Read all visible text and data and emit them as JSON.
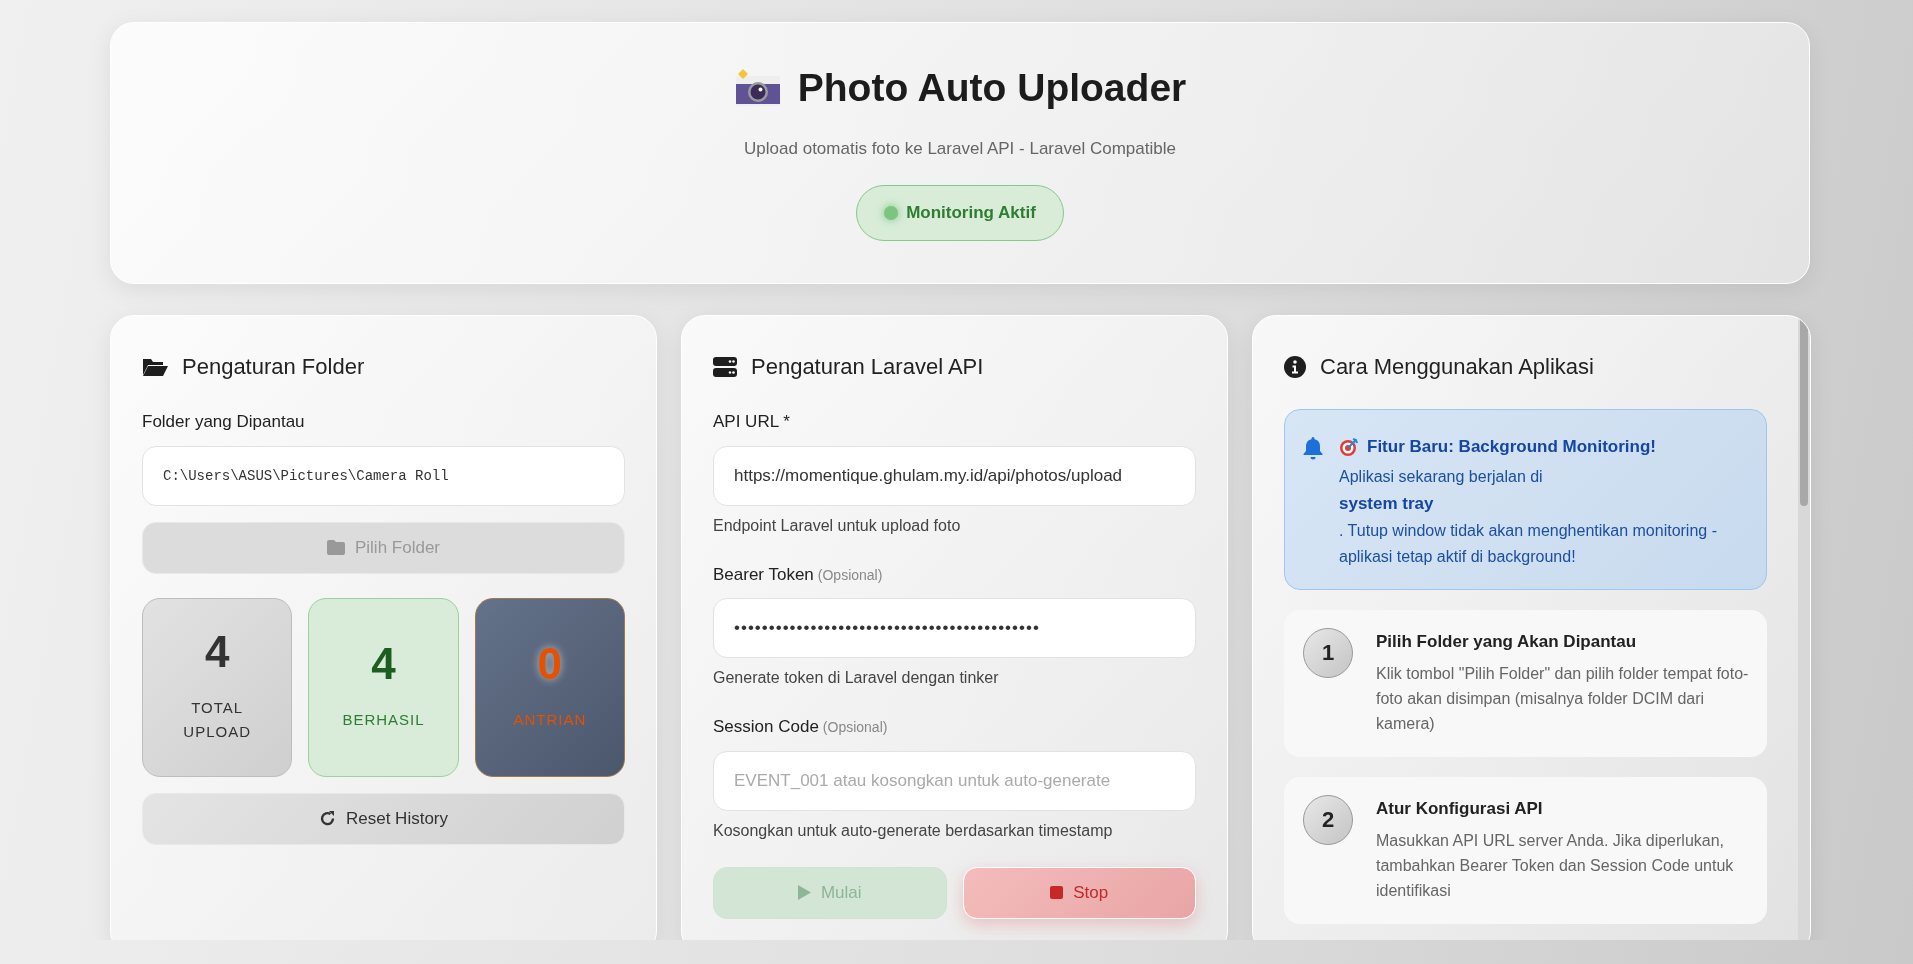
{
  "header": {
    "title": "Photo Auto Uploader",
    "subtitle": "Upload otomatis foto ke Laravel API - Laravel Compatible",
    "status": {
      "label": "Monitoring Aktif",
      "active": true
    }
  },
  "folder_panel": {
    "title": "Pengaturan Folder",
    "field_label": "Folder yang Dipantau",
    "folder_path": "C:\\Users\\ASUS\\Pictures\\Camera Roll",
    "choose_button": {
      "label": "Pilih Folder",
      "disabled": true
    },
    "stats": [
      {
        "kind": "total",
        "value": "4",
        "label": "TOTAL UPLOAD"
      },
      {
        "kind": "success",
        "value": "4",
        "label": "BERHASIL"
      },
      {
        "kind": "queue",
        "value": "0",
        "label": "ANTRIAN"
      }
    ],
    "reset_button": {
      "label": "Reset History"
    }
  },
  "api_panel": {
    "title": "Pengaturan Laravel API",
    "fields": [
      {
        "label": "API URL *",
        "value": "https://momentique.ghulam.my.id/api/photos/upload",
        "help": "Endpoint Laravel untuk upload foto"
      },
      {
        "label": "Bearer Token",
        "optional": "(Opsional)",
        "value": "••••••••••••••••••••••••••••••••••••••••••••",
        "help": "Generate token di Laravel dengan tinker"
      },
      {
        "label": "Session Code",
        "optional": "(Opsional)",
        "placeholder": "EVENT_001 atau kosongkan untuk auto-generate",
        "help": "Kosongkan untuk auto-generate berdasarkan timestamp"
      }
    ],
    "buttons": [
      {
        "kind": "start",
        "label": "Mulai",
        "disabled": true
      },
      {
        "kind": "stop",
        "label": "Stop",
        "disabled": false
      }
    ]
  },
  "help_panel": {
    "title": "Cara Menggunakan Aplikasi",
    "notice": {
      "title": "Fitur Baru: Background Monitoring!",
      "lines": [
        {
          "text": "Aplikasi sekarang berjalan di",
          "bold": false
        },
        {
          "text": "system tray",
          "bold": true
        },
        {
          "text": ". Tutup window tidak akan menghentikan monitoring - aplikasi tetap aktif di background!",
          "bold": false
        }
      ]
    },
    "steps": [
      {
        "number": "1",
        "title": "Pilih Folder yang Akan Dipantau",
        "text": "Klik tombol \"Pilih Folder\" dan pilih folder tempat foto-foto akan disimpan (misalnya folder DCIM dari kamera)"
      },
      {
        "number": "2",
        "title": "Atur Konfigurasi API",
        "text": "Masukkan API URL server Anda. Jika diperlukan, tambahkan Bearer Token dan Session Code untuk identifikasi"
      }
    ]
  }
}
